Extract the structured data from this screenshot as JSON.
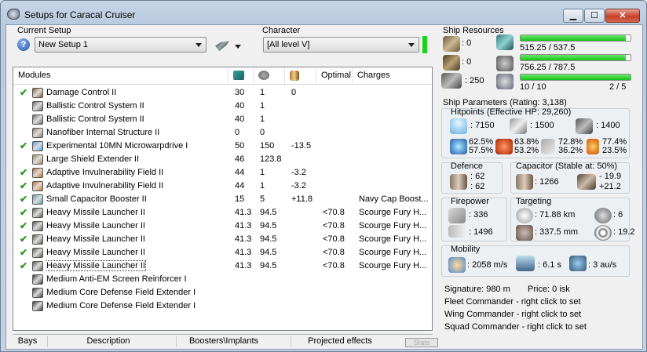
{
  "window": {
    "title": "Setups for Caracal Cruiser",
    "min": "▁",
    "max": "☐",
    "close": "✕"
  },
  "setup": {
    "label": "Current Setup",
    "value": "New Setup 1"
  },
  "character": {
    "label": "Character",
    "value": "[All level V]"
  },
  "columns": {
    "modules": "Modules",
    "optimal": "Optimal",
    "charges": "Charges"
  },
  "modules": [
    {
      "checked": true,
      "name": "Damage Control II",
      "v1": "30",
      "v2": "1",
      "v3": "0",
      "optimal": "",
      "charges": "",
      "color": "#8a5a2a"
    },
    {
      "checked": false,
      "name": "Ballistic Control System II",
      "v1": "40",
      "v2": "1",
      "v3": "",
      "optimal": "",
      "charges": "",
      "color": "#6b6b6b"
    },
    {
      "checked": false,
      "name": "Ballistic Control System II",
      "v1": "40",
      "v2": "1",
      "v3": "",
      "optimal": "",
      "charges": "",
      "color": "#6b6b6b"
    },
    {
      "checked": false,
      "name": "Nanofiber Internal Structure II",
      "v1": "0",
      "v2": "0",
      "v3": "",
      "optimal": "",
      "charges": "",
      "color": "#8b7b6a"
    },
    {
      "checked": true,
      "name": "Experimental 10MN Microwarpdrive I",
      "v1": "50",
      "v2": "150",
      "v3": "-13.5",
      "optimal": "",
      "charges": "",
      "color": "#4aa0d8"
    },
    {
      "checked": false,
      "name": "Large Shield Extender II",
      "v1": "46",
      "v2": "123.8",
      "v3": "",
      "optimal": "",
      "charges": "",
      "color": "#9a8a5a"
    },
    {
      "checked": true,
      "name": "Adaptive Invulnerability Field II",
      "v1": "44",
      "v2": "1",
      "v3": "-3.2",
      "optimal": "",
      "charges": "",
      "color": "#c86a1a"
    },
    {
      "checked": true,
      "name": "Adaptive Invulnerability Field II",
      "v1": "44",
      "v2": "1",
      "v3": "-3.2",
      "optimal": "",
      "charges": "",
      "color": "#c86a1a"
    },
    {
      "checked": true,
      "name": "Small Capacitor Booster II",
      "v1": "15",
      "v2": "5",
      "v3": "+11.8",
      "optimal": "",
      "charges": "Navy Cap Boost...",
      "color": "#5aa0a0"
    },
    {
      "checked": true,
      "name": "Heavy Missile Launcher II",
      "v1": "41.3",
      "v2": "94.5",
      "v3": "",
      "optimal": "<70.8",
      "charges": "Scourge Fury H...",
      "color": "#5a5a4a"
    },
    {
      "checked": true,
      "name": "Heavy Missile Launcher II",
      "v1": "41.3",
      "v2": "94.5",
      "v3": "",
      "optimal": "<70.8",
      "charges": "Scourge Fury H...",
      "color": "#5a5a4a"
    },
    {
      "checked": true,
      "name": "Heavy Missile Launcher II",
      "v1": "41.3",
      "v2": "94.5",
      "v3": "",
      "optimal": "<70.8",
      "charges": "Scourge Fury H...",
      "color": "#5a5a4a"
    },
    {
      "checked": true,
      "name": "Heavy Missile Launcher II",
      "v1": "41.3",
      "v2": "94.5",
      "v3": "",
      "optimal": "<70.8",
      "charges": "Scourge Fury H...",
      "color": "#5a5a4a"
    },
    {
      "checked": true,
      "name": "Heavy Missile Launcher II",
      "v1": "41.3",
      "v2": "94.5",
      "v3": "",
      "optimal": "<70.8",
      "charges": "Scourge Fury H...",
      "color": "#5a5a4a"
    },
    {
      "checked": false,
      "name": "Medium Anti-EM Screen Reinforcer I",
      "v1": "",
      "v2": "",
      "v3": "",
      "optimal": "",
      "charges": "",
      "color": "#3a3a3a"
    },
    {
      "checked": false,
      "name": "Medium Core Defense Field Extender I",
      "v1": "",
      "v2": "",
      "v3": "",
      "optimal": "",
      "charges": "",
      "color": "#3a3a3a"
    },
    {
      "checked": false,
      "name": "Medium Core Defense Field Extender I",
      "v1": "",
      "v2": "",
      "v3": "",
      "optimal": "",
      "charges": "",
      "color": "#3a3a3a"
    }
  ],
  "tabs": [
    "Bays",
    "Description",
    "Boosters\\Implants",
    "Projected effects"
  ],
  "stats_button": "Stats",
  "resources": {
    "title": "Ship Resources",
    "turrets": ": 0",
    "launchers": ": 0",
    "calibration": ": 250",
    "cpu": "515.25 / 537.5",
    "cpu_frac": 0.959,
    "power": "756.25 / 787.5",
    "power_frac": 0.96,
    "drone_bw": "10 / 10",
    "drone_frac": 1.0,
    "drones_active": "2 / 5"
  },
  "params": {
    "title": "Ship Parameters (Rating: 3,138)",
    "hitpoints": {
      "title": "Hitpoints (Effective HP: 29,260)",
      "shield": ": 7150",
      "armor": ": 1500",
      "hull": ": 1400",
      "res1a": "62.5%",
      "res1b": "57.5%",
      "res2a": "63.8%",
      "res2b": "53.2%",
      "res3a": "72.8%",
      "res3b": "36.2%",
      "res4a": "77.4%",
      "res4b": "23.5%"
    },
    "defence": {
      "title": "Defence",
      "a": ": 62",
      "b": ": 62"
    },
    "capacitor": {
      "title": "Capacitor (Stable at: 50%)",
      "amount": ": 1266",
      "delta_a": "- 19.9",
      "delta_b": "+21.2"
    },
    "firepower": {
      "title": "Firepower",
      "a": ": 336",
      "b": ": 1496"
    },
    "targeting": {
      "title": "Targeting",
      "range": ": 71.88 km",
      "targets": ": 6",
      "scan": ": 337.5 mm",
      "sensor": ": 19.2"
    },
    "mobility": {
      "title": "Mobility",
      "speed": ": 2058 m/s",
      "align": ": 6.1 s",
      "warp": ": 3 au/s"
    },
    "signature": "Signature: 980 m",
    "price": "Price: 0 isk",
    "fleet": "Fleet Commander - right click to set",
    "wing": "Wing Commander - right click to set",
    "squad": "Squad Commander - right click to set"
  }
}
